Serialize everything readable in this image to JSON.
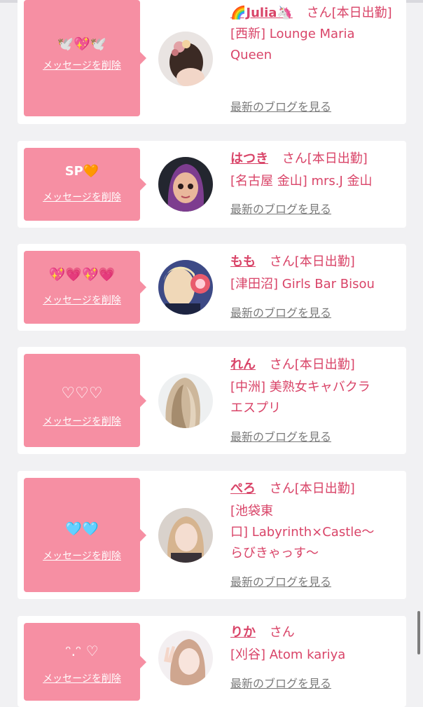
{
  "delete_label": "メッセージを削除",
  "blog_label": "最新のブログを見る",
  "san_label": "さん",
  "colors": {
    "bubble": "#f68fa3",
    "accent": "#d94468",
    "link_gray": "#7b7b7b"
  },
  "cards": [
    {
      "name": "🌈Julia🦄",
      "suffix": "[本日出勤]",
      "store_lines": [
        "[西新] Lounge Maria",
        "Queen"
      ],
      "message": "🕊️💖🕊️",
      "avatar_icon": "hair-accessory-photo-icon"
    },
    {
      "name": "はつき",
      "suffix": "[本日出勤]",
      "store_lines": [
        "[名古屋 金山] mrs.J 金山"
      ],
      "message": "SP🧡",
      "avatar_icon": "cartoon-avatar-icon"
    },
    {
      "name": "もも",
      "suffix": "[本日出勤]",
      "store_lines": [
        "[津田沼] Girls Bar Bisou"
      ],
      "message": "💖💗💖💗",
      "avatar_icon": "selfie-with-plush-icon"
    },
    {
      "name": "れん",
      "suffix": "[本日出勤]",
      "store_lines": [
        "[中洲] 美熟女キャバクラ",
        "エスプリ"
      ],
      "message": "♡♡♡",
      "avatar_icon": "long-hair-photo-icon"
    },
    {
      "name": "ぺろ",
      "suffix": "[本日出勤]",
      "store_lines": [
        "[池袋東",
        "口] Labyrinth×Castle〜",
        "らびきゃっす〜"
      ],
      "message": "🩵🩵",
      "avatar_icon": "portrait-photo-icon"
    },
    {
      "name": "りか",
      "suffix": "",
      "store_lines": [
        "[刈谷] Atom kariya"
      ],
      "message": "ᵔ.ᵔ ♡",
      "avatar_icon": "peace-sign-selfie-icon"
    }
  ]
}
